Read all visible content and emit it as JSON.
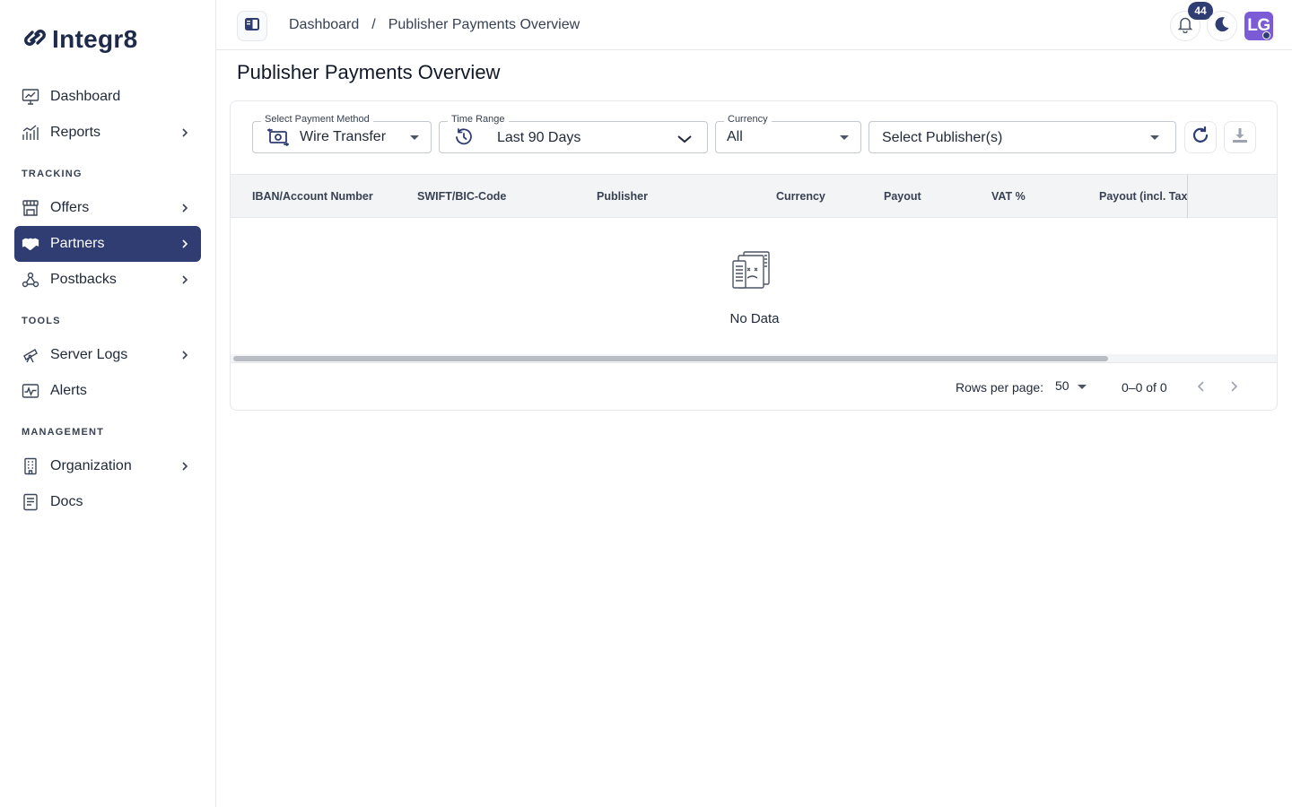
{
  "app": {
    "name": "Integr8"
  },
  "sidebar": {
    "items": [
      {
        "label": "Dashboard",
        "icon": "dashboard-chart-icon",
        "has_children": false
      },
      {
        "label": "Reports",
        "icon": "bar-chart-icon",
        "has_children": true
      }
    ],
    "sections": [
      {
        "title": "TRACKING",
        "items": [
          {
            "label": "Offers",
            "icon": "storefront-icon",
            "has_children": true
          },
          {
            "label": "Partners",
            "icon": "handshake-icon",
            "has_children": true,
            "active": true
          },
          {
            "label": "Postbacks",
            "icon": "webhook-icon",
            "has_children": true
          }
        ]
      },
      {
        "title": "TOOLS",
        "items": [
          {
            "label": "Server Logs",
            "icon": "telescope-icon",
            "has_children": true
          },
          {
            "label": "Alerts",
            "icon": "pulse-icon",
            "has_children": false
          }
        ]
      },
      {
        "title": "MANAGEMENT",
        "items": [
          {
            "label": "Organization",
            "icon": "building-icon",
            "has_children": true
          },
          {
            "label": "Docs",
            "icon": "document-icon",
            "has_children": false
          }
        ]
      }
    ]
  },
  "topbar": {
    "breadcrumb": [
      "Dashboard",
      "/",
      "Publisher Payments Overview"
    ],
    "notifications_count": "44",
    "avatar_initials": "LG"
  },
  "page": {
    "title": "Publisher Payments Overview",
    "filters": {
      "payment_method": {
        "label": "Select Payment Method",
        "value": "Wire Transfer"
      },
      "time_range": {
        "label": "Time Range",
        "value": "Last 90 Days"
      },
      "currency": {
        "label": "Currency",
        "value": "All"
      },
      "publisher": {
        "placeholder": "Select Publisher(s)"
      }
    },
    "table": {
      "columns": [
        "IBAN/Account Number",
        "SWIFT/BIC-Code",
        "Publisher",
        "Currency",
        "Payout",
        "VAT %",
        "Payout (incl. Tax"
      ],
      "rows": [],
      "empty_text": "No Data"
    },
    "pagination": {
      "rows_per_page_label": "Rows per page:",
      "rows_per_page": "50",
      "range": "0–0 of 0"
    }
  },
  "colors": {
    "accent": "#2f3d73",
    "avatar": "#7c5cd6"
  }
}
